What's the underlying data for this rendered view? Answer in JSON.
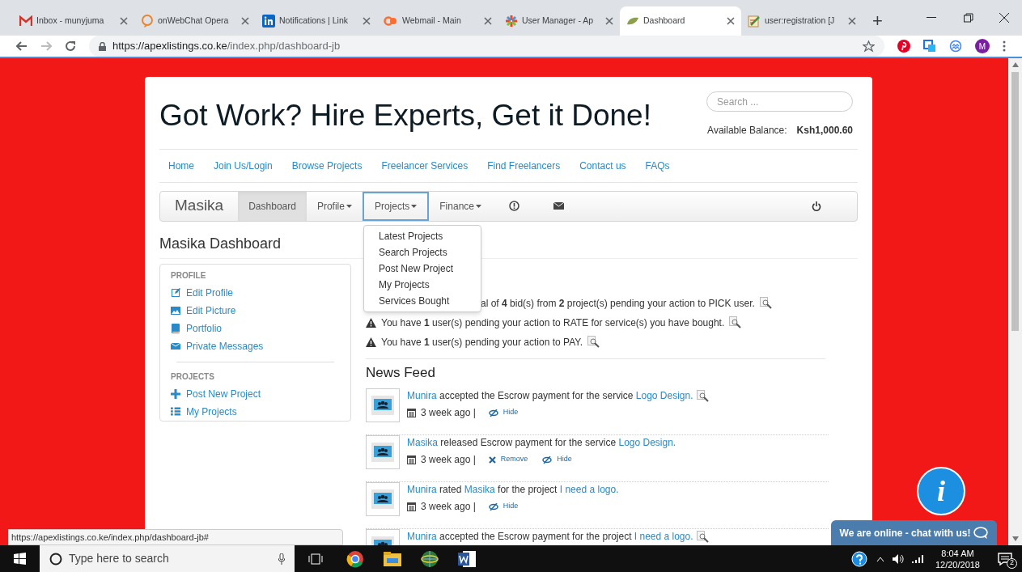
{
  "browser": {
    "tabs": [
      {
        "title": "Inbox - munyjuma",
        "kind": "mail",
        "selected": false
      },
      {
        "title": "onWebChat Opera",
        "kind": "chat",
        "selected": false
      },
      {
        "title": "Notifications | Link",
        "kind": "in",
        "selected": false
      },
      {
        "title": "Webmail - Main",
        "kind": "cp",
        "selected": false
      },
      {
        "title": "User Manager - Ap",
        "kind": "cms",
        "selected": false
      },
      {
        "title": "Dashboard",
        "kind": "leaf",
        "selected": true
      },
      {
        "title": "user:registration [J",
        "kind": "doc",
        "selected": false
      }
    ],
    "new_tab": "+",
    "url_host": "https://apexlistings.co.ke",
    "url_path": "/index.php/dashboard-jb",
    "profile_initial": "M",
    "status_url": "https://apexlistings.co.ke/index.php/dashboard-jb#"
  },
  "site": {
    "title": "Got Work? Hire Experts, Get it Done!",
    "search_placeholder": "Search ...",
    "balance_label": "Available Balance:",
    "balance_value": "Ksh1,000.60",
    "nav": [
      "Home",
      "Join Us/Login",
      "Browse Projects",
      "Freelancer Services",
      "Find Freelancers",
      "Contact us",
      "FAQs"
    ]
  },
  "user_nav": {
    "brand": "Masika",
    "items": [
      {
        "kind": "link",
        "label": "Dashboard",
        "selected": true
      },
      {
        "kind": "dropdown",
        "label": "Profile",
        "selected": false,
        "expanded": false
      },
      {
        "kind": "dropdown",
        "label": "Projects",
        "selected": false,
        "expanded": true
      },
      {
        "kind": "dropdown",
        "label": "Finance",
        "selected": false,
        "expanded": false
      },
      {
        "kind": "alert",
        "selected": false
      },
      {
        "kind": "mail",
        "selected": false
      }
    ]
  },
  "projects_menu": [
    "Latest Projects",
    "Search Projects",
    "Post New Project",
    "My Projects",
    "Services Bought"
  ],
  "dashboard_title": "Masika Dashboard",
  "sidebar": [
    {
      "heading": "PROFILE",
      "items": [
        {
          "label": "Edit Profile",
          "kind": "edit"
        },
        {
          "label": "Edit Picture",
          "kind": "picture"
        },
        {
          "label": "Portfolio",
          "kind": "book"
        },
        {
          "label": "Private Messages",
          "kind": "mail"
        }
      ]
    },
    {
      "heading": "PROJECTS",
      "items": [
        {
          "label": "Post New Project",
          "kind": "plus"
        },
        {
          "label": "My Projects",
          "kind": "list"
        }
      ]
    }
  ],
  "notices": [
    {
      "text": "al of **4** bid(s) from **2** project(s) pending your action to PICK user.",
      "covered": true
    },
    {
      "text": "You have **1** user(s) pending your action to RATE for service(s) you have bought.",
      "covered": false
    },
    {
      "text": "You have **1** user(s) pending your action to PAY.",
      "covered": false
    }
  ],
  "news_feed": {
    "heading": "News Feed",
    "items": [
      {
        "parts": [
          {
            "text": "Munira",
            "link": true
          },
          {
            "text": " accepted the Escrow payment for the service ",
            "link": false
          },
          {
            "text": "Logo Design.",
            "link": true
          }
        ],
        "preview": true,
        "time": "3 week ago |",
        "actions": [
          {
            "kind": "hide",
            "label": "Hide"
          }
        ]
      },
      {
        "parts": [
          {
            "text": "Masika",
            "link": true
          },
          {
            "text": " released Escrow payment for the service ",
            "link": false
          },
          {
            "text": "Logo Design.",
            "link": true
          }
        ],
        "preview": false,
        "time": "3 week ago |",
        "actions": [
          {
            "kind": "remove",
            "label": "Remove"
          },
          {
            "kind": "hide",
            "label": "Hide"
          }
        ]
      },
      {
        "parts": [
          {
            "text": "Munira",
            "link": true
          },
          {
            "text": " rated ",
            "link": false
          },
          {
            "text": "Masika",
            "link": true
          },
          {
            "text": " for the project ",
            "link": false
          },
          {
            "text": "I need a logo.",
            "link": true
          }
        ],
        "preview": false,
        "time": "3 week ago |",
        "actions": [
          {
            "kind": "hide",
            "label": "Hide"
          }
        ]
      },
      {
        "parts": [
          {
            "text": "Munira",
            "link": true
          },
          {
            "text": " accepted the Escrow payment for the project ",
            "link": false
          },
          {
            "text": "I need a logo.",
            "link": true
          }
        ],
        "preview": true
      }
    ]
  },
  "chat": {
    "label": "We are online - chat with us!",
    "badge": "i"
  },
  "taskbar": {
    "search_placeholder": "Type here to search",
    "time": "8:04 AM",
    "date": "12/20/2018",
    "notifications": "2"
  }
}
